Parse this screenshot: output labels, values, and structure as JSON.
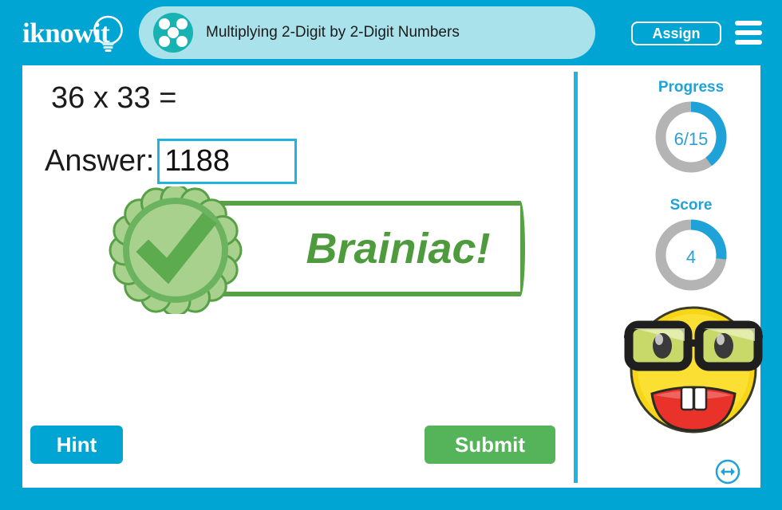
{
  "header": {
    "logo_text": "iknowit",
    "logo_icon": "lightbulb-icon",
    "lesson_icon": "dice-five-dots-icon",
    "title": "Multiplying 2-Digit by 2-Digit Numbers",
    "assign_label": "Assign",
    "menu_icon": "hamburger-menu-icon"
  },
  "question": {
    "prompt": "36 x 33 =",
    "answer_label": "Answer:",
    "answer_value": "1188",
    "answer_placeholder": ""
  },
  "feedback": {
    "text": "Brainiac!",
    "badge_icon": "check-rosette-icon",
    "state": "correct"
  },
  "sidebar": {
    "progress_label": "Progress",
    "progress_value": "6/15",
    "progress_current": 6,
    "progress_total": 15,
    "progress_percent": 40,
    "score_label": "Score",
    "score_value": "4",
    "score_percent": 27,
    "avatar_icon": "nerd-smiley-icon"
  },
  "actions": {
    "hint_label": "Hint",
    "submit_label": "Submit",
    "resize_icon": "resize-arrows-circle-icon"
  },
  "colors": {
    "frame_blue": "#00a5d4",
    "title_bar": "#a9e2ea",
    "lesson_icon_teal": "#18b2b2",
    "accent_blue": "#1fb4e0",
    "ring_track": "#b4b4b4",
    "ring_fill": "#1fa2d8",
    "green": "#55b45a",
    "badge_green": "#4e9b3e",
    "badge_light_green": "#a9d18e"
  }
}
